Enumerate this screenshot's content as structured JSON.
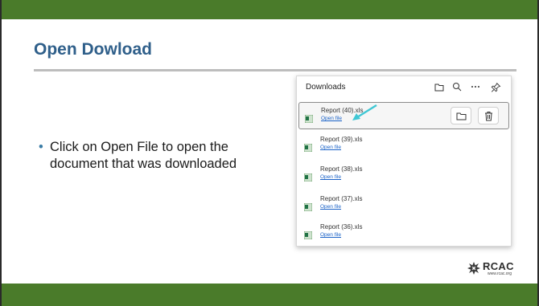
{
  "slide": {
    "title": "Open Dowload",
    "bullet": "Click on Open File to open the document that was downloaded",
    "colors": {
      "band": "#4a7b2a",
      "title": "#2f5f8a",
      "link": "#1a62c7",
      "arrow": "#3fc7d4"
    }
  },
  "downloads": {
    "title": "Downloads",
    "header_icons": [
      "folder-icon",
      "search-icon",
      "more-icon",
      "pin-icon"
    ],
    "items": [
      {
        "file": "Report (40).xls",
        "link": "Open file",
        "selected": true
      },
      {
        "file": "Report (39).xls",
        "link": "Open file"
      },
      {
        "file": "Report (38).xls",
        "link": "Open file"
      },
      {
        "file": "Report (37).xls",
        "link": "Open file"
      },
      {
        "file": "Report (36).xls",
        "link": "Open file"
      }
    ]
  },
  "logo": {
    "name": "RCAC",
    "url": "www.rcac.org"
  }
}
